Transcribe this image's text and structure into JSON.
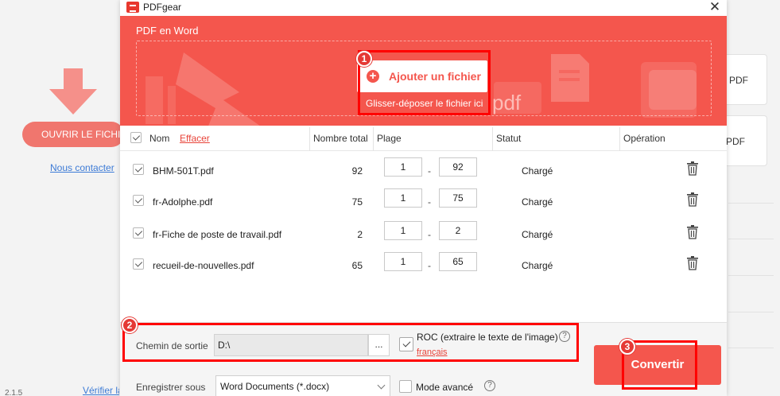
{
  "background": {
    "open_button": "OUVRIR LE FICHIER",
    "contact_link": "Nous contacter",
    "verify_link": "Vérifier la",
    "version": "2.1.5",
    "card1_text": "er PDF",
    "card2_text": "PDF"
  },
  "dialog": {
    "app_title": "PDFgear",
    "close_glyph": "✕",
    "hero_title": "PDF en Word",
    "add_file_label": "Ajouter un fichier",
    "add_file_plus": "+",
    "drop_hint": "Glisser-déposer le fichier ici",
    "deco_text": "pdf"
  },
  "table": {
    "headers": {
      "name": "Nom",
      "clear": "Effacer",
      "total": "Nombre total",
      "range": "Plage",
      "status": "Statut",
      "operation": "Opération"
    },
    "range_separator": "-",
    "rows": [
      {
        "name": "BHM-501T.pdf",
        "total": "92",
        "from": "1",
        "to": "92",
        "status": "Chargé"
      },
      {
        "name": "fr-Adolphe.pdf",
        "total": "75",
        "from": "1",
        "to": "75",
        "status": "Chargé"
      },
      {
        "name": "fr-Fiche de poste de travail.pdf",
        "total": "2",
        "from": "1",
        "to": "2",
        "status": "Chargé"
      },
      {
        "name": "recueil-de-nouvelles.pdf",
        "total": "65",
        "from": "1",
        "to": "65",
        "status": "Chargé"
      }
    ]
  },
  "output": {
    "path_label": "Chemin de sortie",
    "path_value": "D:\\",
    "browse_label": "...",
    "ocr_label": "ROC (extraire le texte de l'image)",
    "ocr_language": "français",
    "help_glyph": "?",
    "save_as_label": "Enregistrer sous",
    "save_as_value": "Word Documents (*.docx)",
    "advanced_label": "Mode avancé",
    "convert_label": "Convertir"
  },
  "annotations": [
    "1",
    "2",
    "3"
  ],
  "colors": {
    "accent": "#f4564d",
    "annotation": "#ff0000",
    "link_red": "#e8443a",
    "link_blue": "#3d7bd6"
  }
}
